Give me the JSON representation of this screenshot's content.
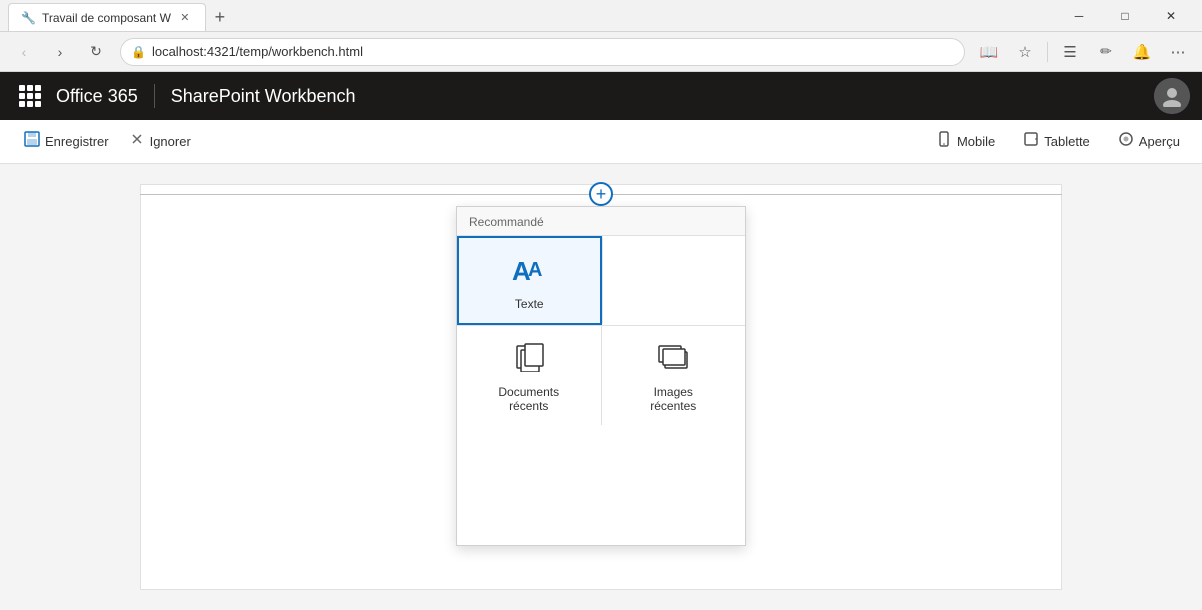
{
  "browser": {
    "titlebar": {
      "tab_label": "Travail de composant W",
      "new_tab_label": "+"
    },
    "window_controls": {
      "minimize": "─",
      "maximize": "□",
      "close": "✕"
    },
    "toolbar": {
      "address": "localhost:4321/temp/workbench.html"
    }
  },
  "app_header": {
    "office365_label": "Office 365",
    "sharepoint_label": "SharePoint Workbench"
  },
  "workbench_toolbar": {
    "save_label": "Enregistrer",
    "discard_label": "Ignorer",
    "mobile_label": "Mobile",
    "tablet_label": "Tablette",
    "preview_label": "Aperçu"
  },
  "popup": {
    "section_recommended": "Recommandé",
    "item_text_label": "Texte",
    "item_docs_label": "Documents\nrécents",
    "item_images_label": "Images\nrécentes"
  }
}
